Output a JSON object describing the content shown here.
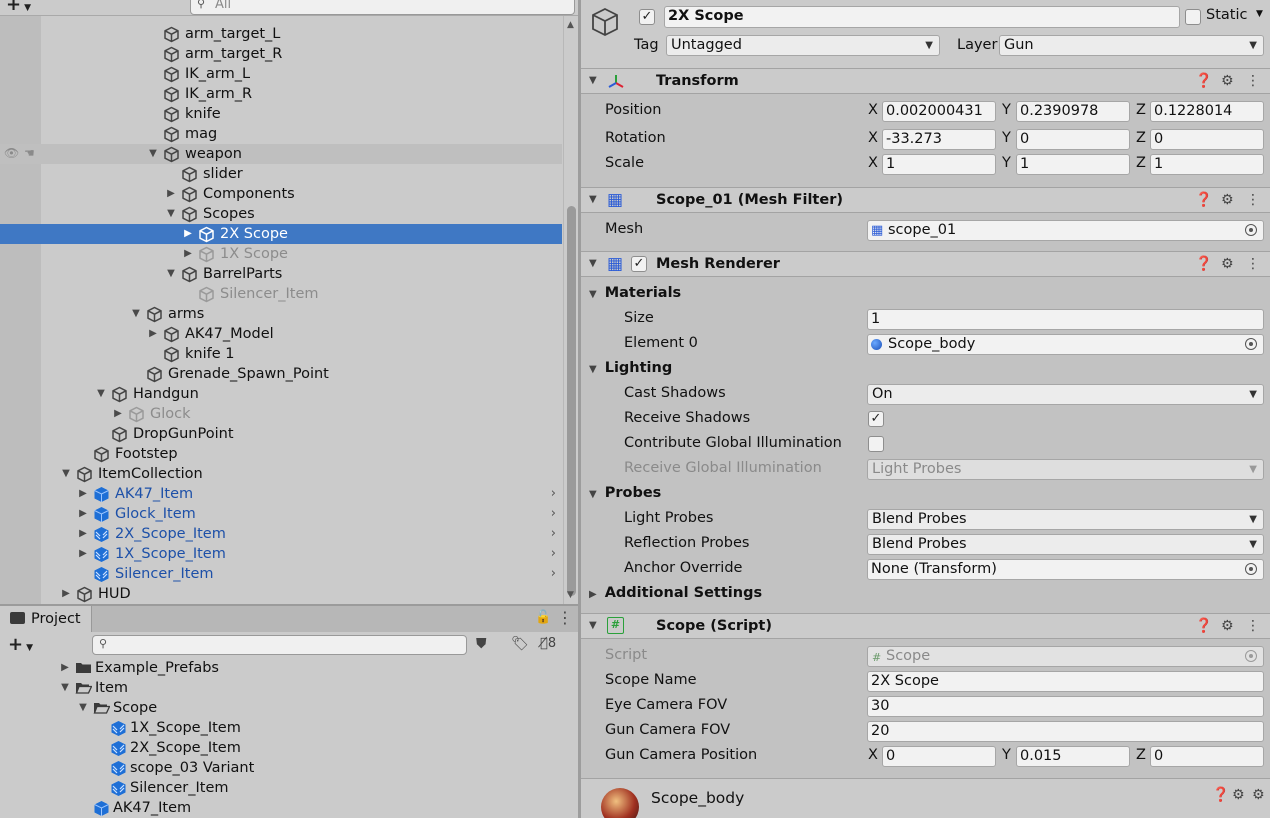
{
  "hierarchy": {
    "search_placeholder": "All",
    "rows": [
      {
        "label": "arm_target_L",
        "indent": 185,
        "arrow": "",
        "style": "",
        "icon": "cube"
      },
      {
        "label": "arm_target_R",
        "indent": 185,
        "arrow": "",
        "style": "",
        "icon": "cube"
      },
      {
        "label": "IK_arm_L",
        "indent": 185,
        "arrow": "",
        "style": "",
        "icon": "cube"
      },
      {
        "label": "IK_arm_R",
        "indent": 185,
        "arrow": "",
        "style": "",
        "icon": "cube"
      },
      {
        "label": "knife",
        "indent": 185,
        "arrow": "",
        "style": "",
        "icon": "cube"
      },
      {
        "label": "mag",
        "indent": 185,
        "arrow": "",
        "style": "",
        "icon": "cube"
      },
      {
        "label": "weapon",
        "indent": 185,
        "arrow": "down",
        "style": "hov",
        "icon": "cube"
      },
      {
        "label": "slider",
        "indent": 203,
        "arrow": "",
        "style": "",
        "icon": "cube"
      },
      {
        "label": "Components",
        "indent": 203,
        "arrow": "right",
        "style": "",
        "icon": "cube"
      },
      {
        "label": "Scopes",
        "indent": 203,
        "arrow": "down",
        "style": "",
        "icon": "cube"
      },
      {
        "label": "2X Scope",
        "indent": 220,
        "arrow": "right",
        "style": "sel",
        "icon": "cube"
      },
      {
        "label": "1X Scope",
        "indent": 220,
        "arrow": "right",
        "style": "dim",
        "icon": "cube"
      },
      {
        "label": "BarrelParts",
        "indent": 203,
        "arrow": "down",
        "style": "",
        "icon": "cube"
      },
      {
        "label": "Silencer_Item",
        "indent": 220,
        "arrow": "",
        "style": "dim",
        "icon": "cube"
      },
      {
        "label": "arms",
        "indent": 168,
        "arrow": "down",
        "style": "",
        "icon": "cube"
      },
      {
        "label": "AK47_Model",
        "indent": 185,
        "arrow": "right",
        "style": "",
        "icon": "cube"
      },
      {
        "label": "knife 1",
        "indent": 185,
        "arrow": "",
        "style": "",
        "icon": "cube"
      },
      {
        "label": "Grenade_Spawn_Point",
        "indent": 168,
        "arrow": "",
        "style": "",
        "icon": "cube"
      },
      {
        "label": "Handgun",
        "indent": 133,
        "arrow": "down",
        "style": "",
        "icon": "cube"
      },
      {
        "label": "Glock",
        "indent": 150,
        "arrow": "right",
        "style": "dim",
        "icon": "cube"
      },
      {
        "label": "DropGunPoint",
        "indent": 133,
        "arrow": "",
        "style": "",
        "icon": "cube"
      },
      {
        "label": "Footstep",
        "indent": 115,
        "arrow": "",
        "style": "",
        "icon": "cube"
      },
      {
        "label": "ItemCollection",
        "indent": 98,
        "arrow": "down",
        "style": "",
        "icon": "cube"
      },
      {
        "label": "AK47_Item",
        "indent": 115,
        "arrow": "right",
        "style": "pref",
        "icon": "prefab",
        "chevron": "›"
      },
      {
        "label": "Glock_Item",
        "indent": 115,
        "arrow": "right",
        "style": "pref",
        "icon": "prefab",
        "chevron": "›"
      },
      {
        "label": "2X_Scope_Item",
        "indent": 115,
        "arrow": "right",
        "style": "pref",
        "icon": "variant",
        "chevron": "›"
      },
      {
        "label": "1X_Scope_Item",
        "indent": 115,
        "arrow": "right",
        "style": "pref",
        "icon": "variant",
        "chevron": "›"
      },
      {
        "label": "Silencer_Item",
        "indent": 115,
        "arrow": "",
        "style": "pref",
        "icon": "variant",
        "chevron": "›"
      },
      {
        "label": "HUD",
        "indent": 98,
        "arrow": "right",
        "style": "",
        "icon": "cube"
      }
    ]
  },
  "project": {
    "tab_label": "Project",
    "hidden_count": "8",
    "rows": [
      {
        "label": "Example_Prefabs",
        "indent": 95,
        "arrow": "right",
        "icon": "folder"
      },
      {
        "label": "Item",
        "indent": 95,
        "arrow": "down",
        "icon": "folder-open"
      },
      {
        "label": "Scope",
        "indent": 113,
        "arrow": "down",
        "icon": "folder-open"
      },
      {
        "label": "1X_Scope_Item",
        "indent": 130,
        "arrow": "",
        "icon": "variant"
      },
      {
        "label": "2X_Scope_Item",
        "indent": 130,
        "arrow": "",
        "icon": "variant"
      },
      {
        "label": "scope_03 Variant",
        "indent": 130,
        "arrow": "",
        "icon": "variant"
      },
      {
        "label": "Silencer_Item",
        "indent": 130,
        "arrow": "",
        "icon": "variant"
      },
      {
        "label": "AK47_Item",
        "indent": 113,
        "arrow": "",
        "icon": "prefab"
      }
    ]
  },
  "inspector": {
    "object_name": "2X Scope",
    "static_label": "Static",
    "tag_label": "Tag",
    "tag_value": "Untagged",
    "layer_label": "Layer",
    "layer_value": "Gun",
    "transform": {
      "title": "Transform",
      "position_label": "Position",
      "rotation_label": "Rotation",
      "scale_label": "Scale",
      "position": [
        "0.002000431",
        "0.2390978",
        "0.1228014"
      ],
      "rotation": [
        "-33.273",
        "0",
        "0"
      ],
      "scale": [
        "1",
        "1",
        "1"
      ],
      "axes": [
        "X",
        "Y",
        "Z"
      ]
    },
    "mesh_filter": {
      "title": "Scope_01 (Mesh Filter)",
      "mesh_label": "Mesh",
      "mesh_value": "scope_01"
    },
    "mesh_renderer": {
      "title": "Mesh Renderer",
      "materials": "Materials",
      "size_label": "Size",
      "size_value": "1",
      "element0_label": "Element 0",
      "element0_value": "Scope_body",
      "lighting": "Lighting",
      "cast_shadows_label": "Cast Shadows",
      "cast_shadows_value": "On",
      "receive_shadows_label": "Receive Shadows",
      "contribute_gi_label": "Contribute Global Illumination",
      "receive_gi_label": "Receive Global Illumination",
      "receive_gi_value": "Light Probes",
      "probes": "Probes",
      "light_probes_label": "Light Probes",
      "light_probes_value": "Blend Probes",
      "reflection_probes_label": "Reflection Probes",
      "reflection_probes_value": "Blend Probes",
      "anchor_label": "Anchor Override",
      "anchor_value": "None (Transform)",
      "additional": "Additional Settings"
    },
    "scope_script": {
      "title": "Scope (Script)",
      "script_label": "Script",
      "script_value": "Scope",
      "scope_name_label": "Scope Name",
      "scope_name_value": "2X Scope",
      "eye_fov_label": "Eye Camera FOV",
      "eye_fov_value": "30",
      "gun_fov_label": "Gun Camera FOV",
      "gun_fov_value": "20",
      "gun_pos_label": "Gun Camera Position",
      "gun_pos": [
        "0",
        "0.015",
        "0"
      ]
    },
    "material": {
      "name": "Scope_body"
    }
  },
  "colors": {
    "selection": "#3f78c4",
    "prefab_text": "#1d50a8",
    "prefab_icon": "#1e6fd6"
  }
}
